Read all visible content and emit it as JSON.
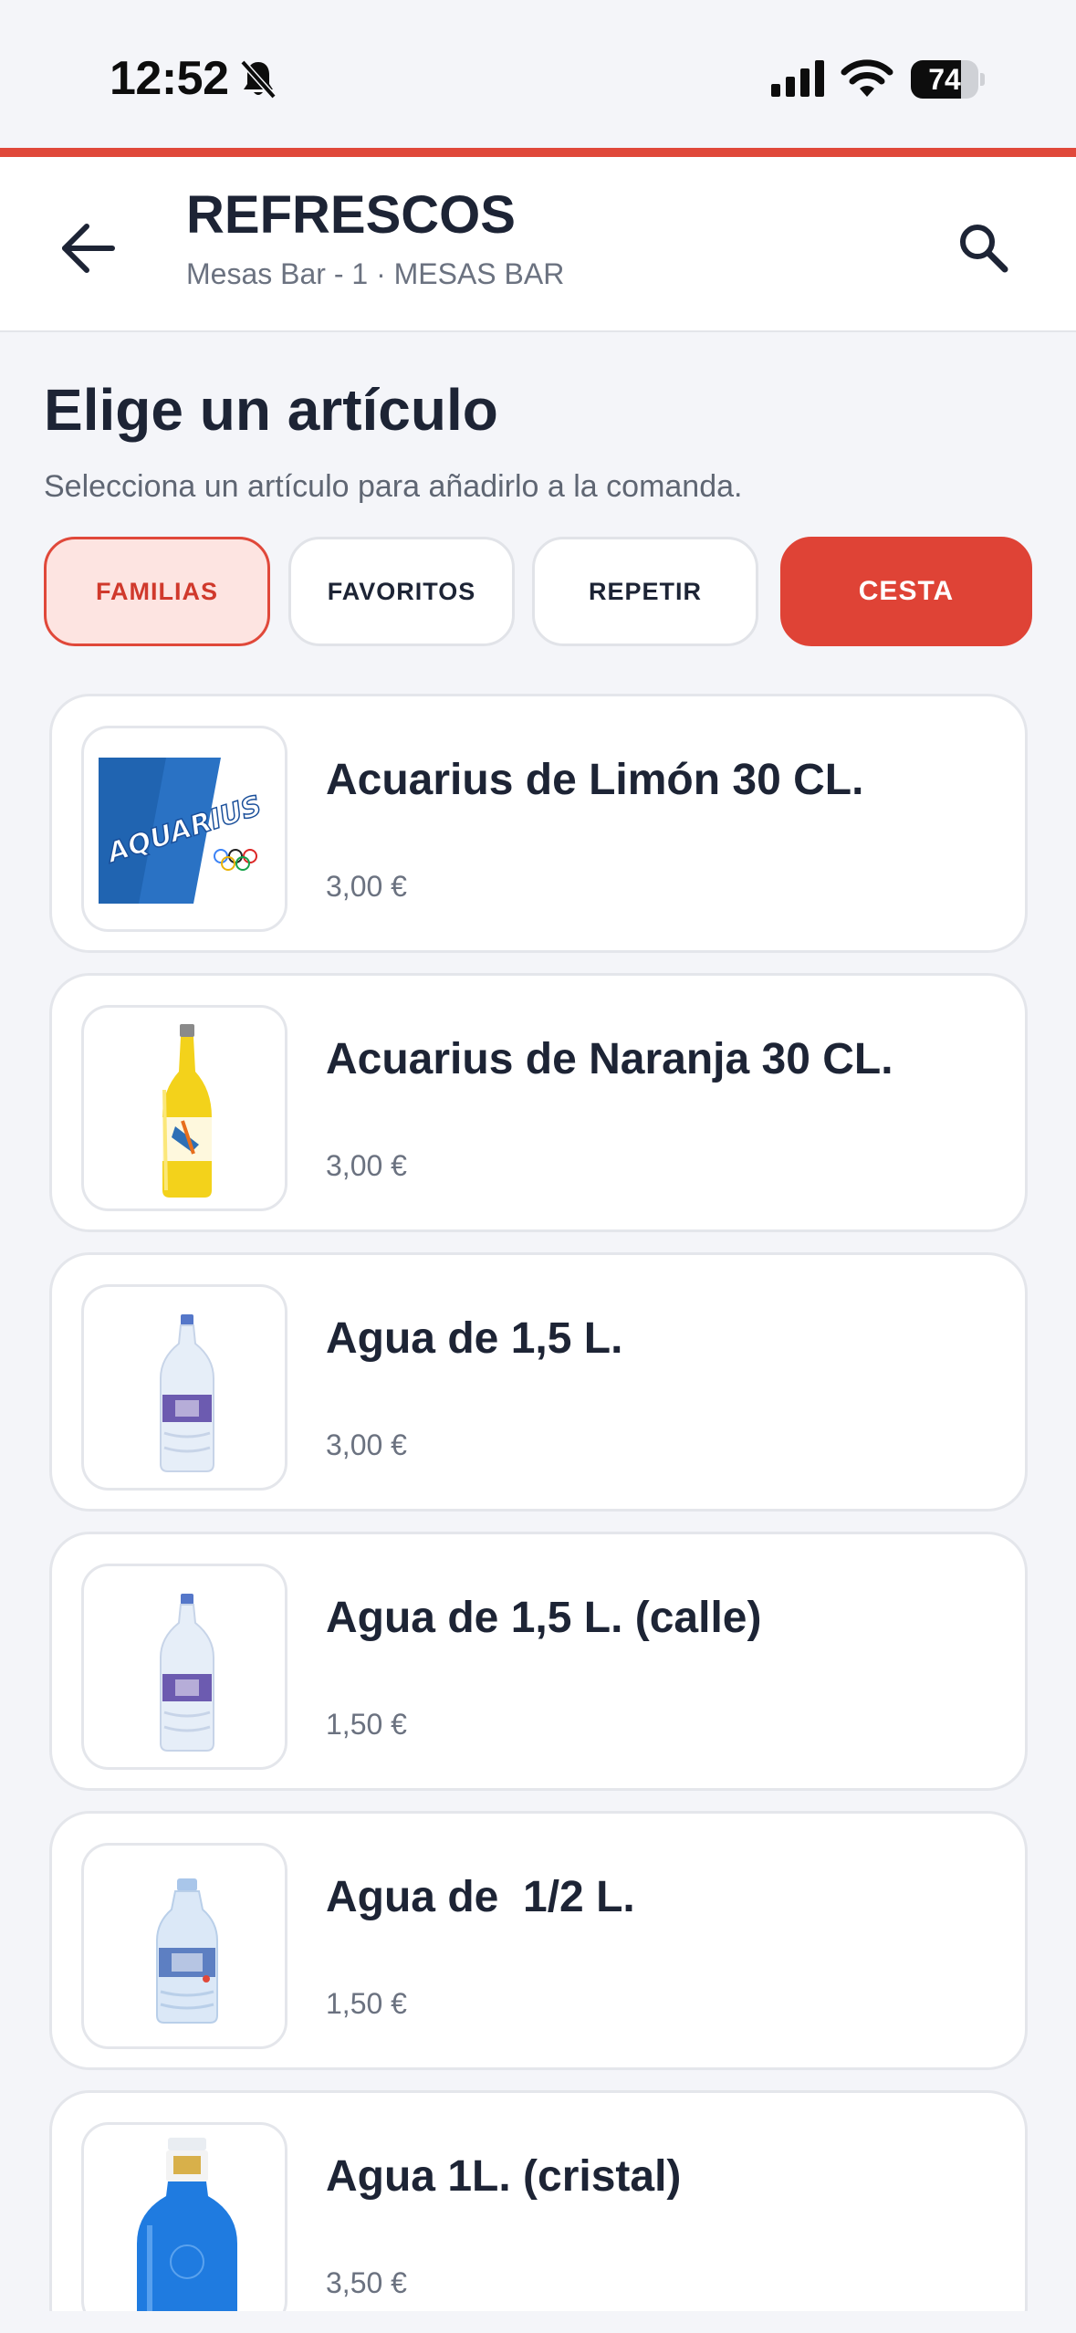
{
  "status_bar": {
    "time": "12:52",
    "battery_level": 74,
    "battery_label": "74"
  },
  "header": {
    "title": "REFRESCOS",
    "subtitle": "Mesas Bar - 1 · MESAS BAR"
  },
  "section": {
    "title": "Elige un artículo",
    "subtitle": "Selecciona un artículo para añadirlo a la comanda."
  },
  "tabs": [
    {
      "label": "FAMILIAS",
      "state": "selected"
    },
    {
      "label": "FAVORITOS"
    },
    {
      "label": "REPETIR"
    },
    {
      "label": "CESTA",
      "style": "primary"
    }
  ],
  "colors": {
    "accent": "#e0483a",
    "background": "#f4f5f9"
  },
  "products": [
    {
      "name": "Acuarius de Limón 30 CL.",
      "price": "3,00 €",
      "image": "aquarius-logo"
    },
    {
      "name": "Acuarius de Naranja 30 CL.",
      "price": "3,00 €",
      "image": "orange-bottle"
    },
    {
      "name": "Agua de 1,5 L.",
      "price": "3,00 €",
      "image": "water-bottle-large"
    },
    {
      "name": "Agua de 1,5 L. (calle)",
      "price": "1,50 €",
      "image": "water-bottle-large"
    },
    {
      "name": "Agua de  1/2 L.",
      "price": "1,50 €",
      "image": "water-bottle-small"
    },
    {
      "name": "Agua 1L. (cristal)",
      "price": "3,50 €",
      "image": "blue-glass-bottle"
    }
  ]
}
